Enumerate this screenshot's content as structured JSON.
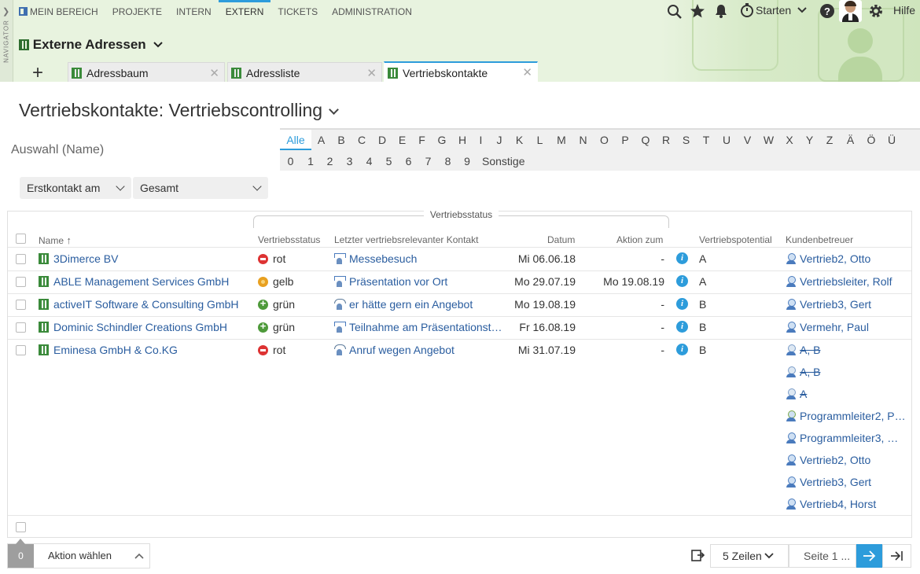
{
  "navigator_label": "NAVIGATOR",
  "topnav": [
    {
      "label": "MEIN BEREICH"
    },
    {
      "label": "PROJEKTE"
    },
    {
      "label": "INTERN"
    },
    {
      "label": "EXTERN"
    },
    {
      "label": "TICKETS"
    },
    {
      "label": "ADMINISTRATION"
    }
  ],
  "tools": {
    "start_label": "Starten",
    "help_label": "Hilfe"
  },
  "workspace_title": "Externe Adressen",
  "tabs": [
    {
      "label": "Adressbaum"
    },
    {
      "label": "Adressliste"
    },
    {
      "label": "Vertriebskontakte"
    }
  ],
  "page_title": "Vertriebskontakte: Vertriebscontrolling",
  "auswahl_label": "Auswahl (Name)",
  "alphabet_row1": [
    "Alle",
    "A",
    "B",
    "C",
    "D",
    "E",
    "F",
    "G",
    "H",
    "I",
    "J",
    "K",
    "L",
    "M",
    "N",
    "O",
    "P",
    "Q",
    "R",
    "S",
    "T",
    "U",
    "V",
    "W",
    "X",
    "Y",
    "Z",
    "Ä",
    "Ö",
    "Ü"
  ],
  "alphabet_row2": [
    "0",
    "1",
    "2",
    "3",
    "4",
    "5",
    "6",
    "7",
    "8",
    "9",
    "Sonstige"
  ],
  "filters": {
    "field": "Erstkontakt am",
    "range": "Gesamt"
  },
  "table": {
    "group_header": "Vertriebsstatus",
    "headers": {
      "name": "Name",
      "status": "Vertriebsstatus",
      "kontakt": "Letzter vertriebsrelevanter Kontakt",
      "datum": "Datum",
      "aktion": "Aktion zum",
      "potential": "Vertriebspotential",
      "betreuer": "Kundenbetreuer"
    },
    "rows": [
      {
        "name": "3Dimerce BV",
        "status": "rot",
        "kontakt": "Messebesuch",
        "datum": "Mi 06.06.18",
        "aktion": "-",
        "potential": "A",
        "betreuer": [
          "Vertrieb2, Otto"
        ]
      },
      {
        "name": "ABLE Management Services GmbH",
        "status": "gelb",
        "kontakt": "Präsentation vor Ort",
        "datum": "Mo 29.07.19",
        "aktion": "Mo 19.08.19",
        "potential": "A",
        "betreuer": [
          "Vertriebsleiter, Rolf"
        ]
      },
      {
        "name": "activeIT Software & Consulting GmbH",
        "status": "grün",
        "kontakt": "er hätte gern ein Angebot",
        "datum": "Mo 19.08.19",
        "aktion": "-",
        "potential": "B",
        "betreuer": [
          "Vertrieb3, Gert"
        ]
      },
      {
        "name": "Dominic Schindler Creations GmbH",
        "status": "grün",
        "kontakt": "Teilnahme am Präsentationst…",
        "datum": "Fr 16.08.19",
        "aktion": "-",
        "potential": "B",
        "betreuer": [
          "Vermehr, Paul"
        ]
      },
      {
        "name": "Eminesa GmbH & Co.KG",
        "status": "rot",
        "kontakt": "Anruf wegen Angebot",
        "datum": "Mi 31.07.19",
        "aktion": "-",
        "potential": "B",
        "betreuer": [
          "A, B",
          "A, B",
          "A",
          "Programmleiter2, P…",
          "Programmleiter3, …",
          "Vertrieb2, Otto",
          "Vertrieb3, Gert",
          "Vertrieb4, Horst"
        ]
      }
    ]
  },
  "footer": {
    "selected_count": "0",
    "action_label": "Aktion wählen",
    "rows_label": "5 Zeilen",
    "page_label": "Seite 1 ..."
  },
  "colors": {
    "accent": "#2d9cdb",
    "link": "#2a5d9f",
    "status_rot": "#dd3333",
    "status_gelb": "#e8a020",
    "status_gruen": "#4e9a3a",
    "header_bg": "#e8f3df"
  }
}
